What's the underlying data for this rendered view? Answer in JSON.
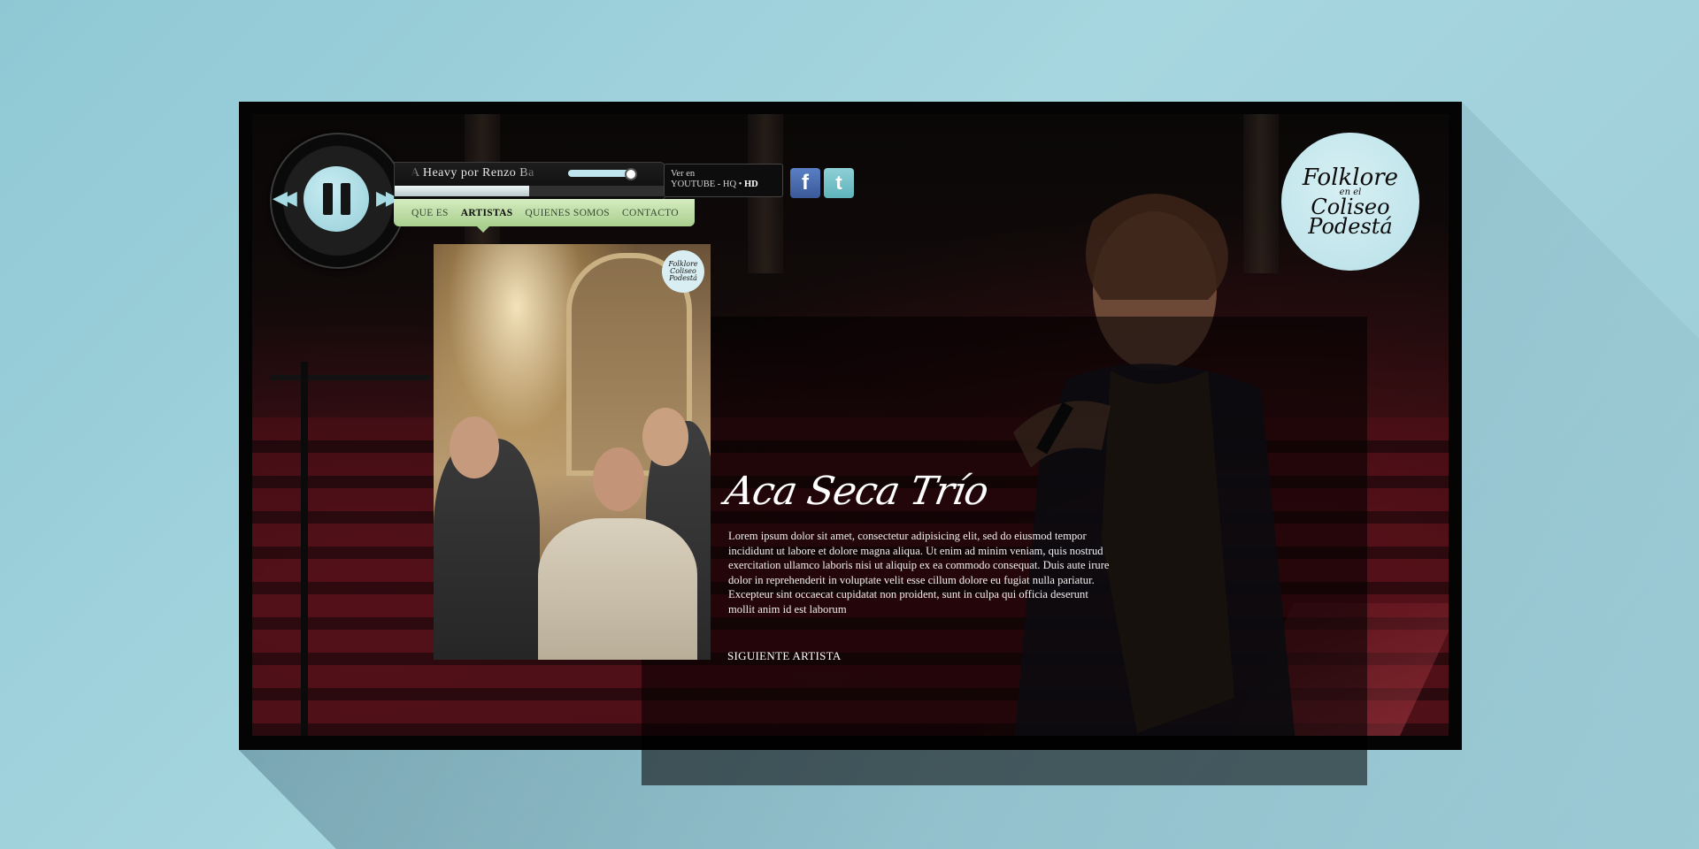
{
  "player": {
    "track_title": "A Heavy por Renzo Ba",
    "volume_fraction": 0.8,
    "progress_fraction": 0.5,
    "hd": {
      "line1": "Ver en",
      "line2_prefix": "YOUTUBE - HQ • ",
      "line2_bold": "HD"
    }
  },
  "social": {
    "facebook_icon": "f",
    "twitter_icon": "t"
  },
  "nav": {
    "items": [
      {
        "label": "QUE ES",
        "active": false
      },
      {
        "label": "ARTISTAS",
        "active": true
      },
      {
        "label": "QUIENES SOMOS",
        "active": false
      },
      {
        "label": "CONTACTO",
        "active": false
      }
    ]
  },
  "logo": {
    "line1": "Folklore",
    "line2": "en el",
    "line3": "Coliseo",
    "line4": "Podestá"
  },
  "photo_badge": {
    "line1": "Folklore",
    "line2": "Coliseo",
    "line3": "Podestá"
  },
  "artist": {
    "name": "Aca Seca Trío",
    "bio": "Lorem ipsum dolor sit amet, consectetur adipisicing elit, sed do eiusmod tempor incididunt ut labore et dolore magna aliqua. Ut enim ad minim veniam, quis nostrud exercitation ullamco laboris nisi ut aliquip ex ea commodo consequat. Duis aute irure dolor in reprehenderit in voluptate velit esse cillum dolore eu fugiat nulla pariatur. Excepteur sint occaecat cupidatat non proident, sunt in culpa qui officia deserunt mollit anim id est laborum",
    "next_label": "SIGUIENTE ARTISTA"
  },
  "colors": {
    "accent_blue": "#a7dbe4",
    "nav_green": "#c4e2aa",
    "background": "#9ccbd6"
  }
}
